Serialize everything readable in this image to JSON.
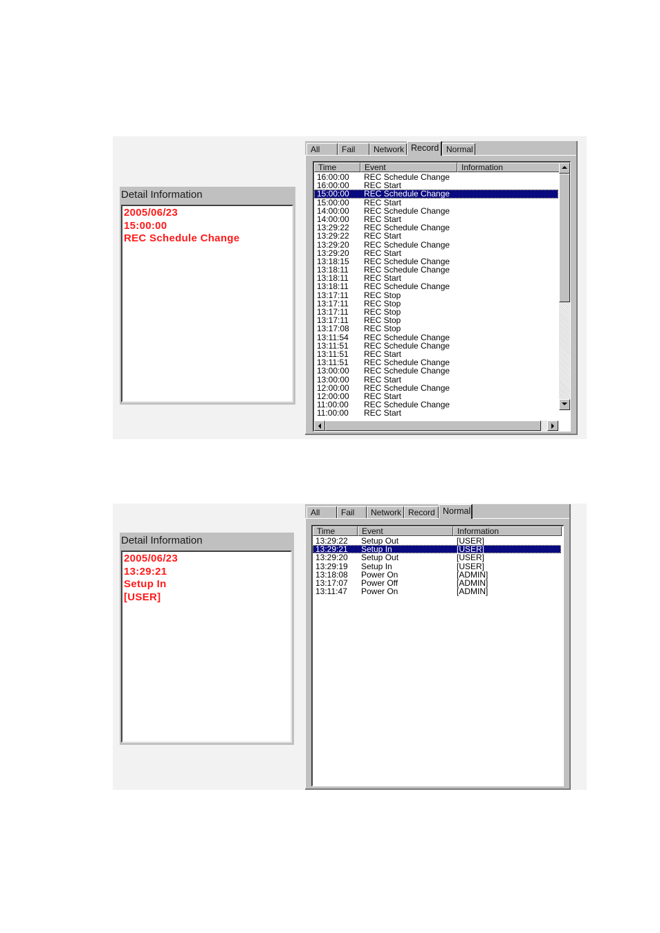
{
  "screens": [
    {
      "detail": {
        "title": "Detail Information",
        "lines": [
          "2005/06/23",
          "15:00:00",
          "REC Schedule Change"
        ]
      },
      "tabs": [
        {
          "label": "All",
          "active": false
        },
        {
          "label": "Fail",
          "active": false
        },
        {
          "label": "Network",
          "active": false
        },
        {
          "label": "Record",
          "active": true
        },
        {
          "label": "Normal",
          "active": false
        }
      ],
      "columns": [
        "Time",
        "Event",
        "Information"
      ],
      "selected_index": 2,
      "rows": [
        {
          "time": "16:00:00",
          "event": "REC Schedule Change",
          "info": ""
        },
        {
          "time": "16:00:00",
          "event": "REC Start",
          "info": ""
        },
        {
          "time": "15:00:00",
          "event": "REC Schedule Change",
          "info": ""
        },
        {
          "time": "15:00:00",
          "event": "REC Start",
          "info": ""
        },
        {
          "time": "14:00:00",
          "event": "REC Schedule Change",
          "info": ""
        },
        {
          "time": "14:00:00",
          "event": "REC Start",
          "info": ""
        },
        {
          "time": "13:29:22",
          "event": "REC Schedule Change",
          "info": ""
        },
        {
          "time": "13:29:22",
          "event": "REC Start",
          "info": ""
        },
        {
          "time": "13:29:20",
          "event": "REC Schedule Change",
          "info": ""
        },
        {
          "time": "13:29:20",
          "event": "REC Start",
          "info": ""
        },
        {
          "time": "13:18:15",
          "event": "REC Schedule Change",
          "info": ""
        },
        {
          "time": "13:18:11",
          "event": "REC Schedule Change",
          "info": ""
        },
        {
          "time": "13:18:11",
          "event": "REC Start",
          "info": ""
        },
        {
          "time": "13:18:11",
          "event": "REC Schedule Change",
          "info": ""
        },
        {
          "time": "13:17:11",
          "event": "REC Stop",
          "info": ""
        },
        {
          "time": "13:17:11",
          "event": "REC Stop",
          "info": ""
        },
        {
          "time": "13:17:11",
          "event": "REC Stop",
          "info": ""
        },
        {
          "time": "13:17:11",
          "event": "REC Stop",
          "info": ""
        },
        {
          "time": "13:17:08",
          "event": "REC Stop",
          "info": ""
        },
        {
          "time": "13:11:54",
          "event": "REC Schedule Change",
          "info": ""
        },
        {
          "time": "13:11:51",
          "event": "REC Schedule Change",
          "info": ""
        },
        {
          "time": "13:11:51",
          "event": "REC Start",
          "info": ""
        },
        {
          "time": "13:11:51",
          "event": "REC Schedule Change",
          "info": ""
        },
        {
          "time": "13:00:00",
          "event": "REC Schedule Change",
          "info": ""
        },
        {
          "time": "13:00:00",
          "event": "REC Start",
          "info": ""
        },
        {
          "time": "12:00:00",
          "event": "REC Schedule Change",
          "info": ""
        },
        {
          "time": "12:00:00",
          "event": "REC Start",
          "info": ""
        },
        {
          "time": "11:00:00",
          "event": "REC Schedule Change",
          "info": ""
        },
        {
          "time": "11:00:00",
          "event": "REC Start",
          "info": ""
        }
      ],
      "has_scrollbars": true
    },
    {
      "detail": {
        "title": "Detail Information",
        "lines": [
          "2005/06/23",
          "13:29:21",
          "Setup In",
          "[USER]"
        ]
      },
      "tabs": [
        {
          "label": "All",
          "active": false
        },
        {
          "label": "Fail",
          "active": false
        },
        {
          "label": "Network",
          "active": false
        },
        {
          "label": "Record",
          "active": false
        },
        {
          "label": "Normal",
          "active": true
        }
      ],
      "columns": [
        "Time",
        "Event",
        "Information"
      ],
      "selected_index": 1,
      "rows": [
        {
          "time": "13:29:22",
          "event": "Setup Out",
          "info": "[USER]"
        },
        {
          "time": "13:29:21",
          "event": "Setup In",
          "info": "[USER]"
        },
        {
          "time": "13:29:20",
          "event": "Setup Out",
          "info": "[USER]"
        },
        {
          "time": "13:29:19",
          "event": "Setup In",
          "info": "[USER]"
        },
        {
          "time": "13:18:08",
          "event": "Power On",
          "info": "[ADMIN]"
        },
        {
          "time": "13:17:07",
          "event": "Power Off",
          "info": "[ADMIN]"
        },
        {
          "time": "13:11:47",
          "event": "Power On",
          "info": "[ADMIN]"
        }
      ],
      "has_scrollbars": false
    }
  ],
  "colors": {
    "detail_text": "#ff1a1a",
    "selection_bg": "#0a0a80",
    "panel_bg": "#c0c0c0",
    "screen_bg": "#f2f2f2"
  }
}
